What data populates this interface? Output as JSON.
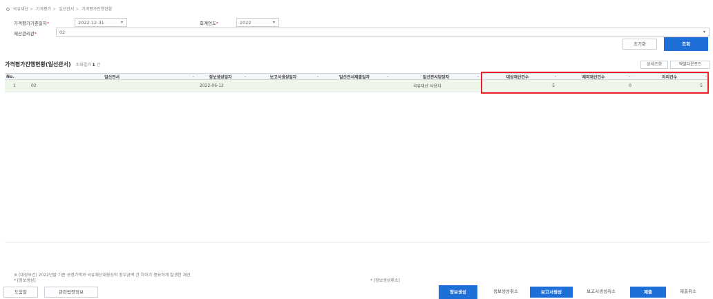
{
  "breadcrumb": [
    "국유재산",
    "가격평가",
    "일선관서",
    "가격평가진행현황"
  ],
  "filters": {
    "base_date_label": "가격평가기준일자",
    "base_date_value": "2022-12-31",
    "fiscal_year_label": "회계연도",
    "fiscal_year_value": "2022",
    "asset_org_label": "재산관리관",
    "asset_org_value": "02"
  },
  "buttons": {
    "reset": "초기화",
    "search": "조회",
    "detail_search": "상세조회",
    "excel_download": "엑셀다운로드",
    "help": "도움말",
    "related_law": "관련법령정보",
    "create_info": "정보생성",
    "cancel_info": "정보생성취소",
    "create_report": "보고서생성",
    "cancel_report": "보고서생성취소",
    "submit": "제출",
    "cancel_submit": "제출취소"
  },
  "section": {
    "title": "가격평가진행현황(일선관서)",
    "count_prefix": "조회결과",
    "count_value": "1",
    "count_suffix": "건"
  },
  "table": {
    "columns": [
      "No.",
      "일선관서",
      "정보생성일자",
      "보고서생성일자",
      "일선관서제출일자",
      "일선관서담당자",
      "대상재산건수",
      "제외재산건수",
      "처리건수"
    ],
    "rows": [
      [
        "1",
        "02",
        "2022-06-12",
        "",
        "",
        "국유재산 사용자",
        "5",
        "0",
        "5"
      ]
    ]
  },
  "notes": {
    "condition": "※ (대상요건) 2022년말 기준 공정가액과 국유재산대장상의 장부금액 간 차이가 중요하게 발생한 재산",
    "create_header": "* [정보생성]",
    "cancel_header": "* [정보생성취소]"
  }
}
